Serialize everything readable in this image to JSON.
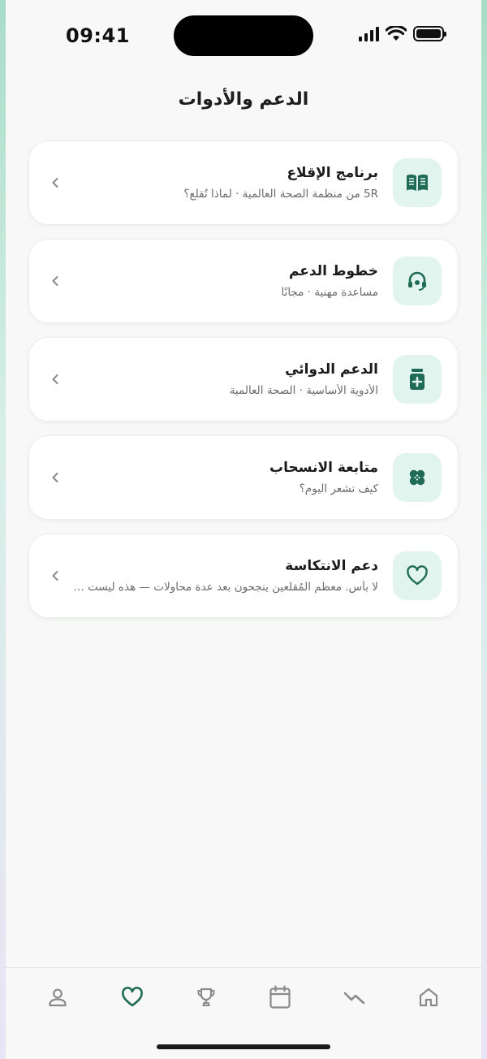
{
  "status_bar": {
    "time": "09:41"
  },
  "header": {
    "title": "الدعم والأدوات"
  },
  "cards": [
    {
      "title": "برنامج الإقلاع",
      "subtitle": "5R من منظمة الصحة العالمية · لماذا تُقلع؟",
      "icon": "book-icon"
    },
    {
      "title": "خطوط الدعم",
      "subtitle": "مساعدة مهنية · مجانًا",
      "icon": "headset-icon"
    },
    {
      "title": "الدعم الدوائي",
      "subtitle": "الأدوية الأساسية · الصحة العالمية",
      "icon": "medicine-icon"
    },
    {
      "title": "متابعة الانسحاب",
      "subtitle": "كيف تشعر اليوم؟",
      "icon": "bandage-icon"
    },
    {
      "title": "دعم الانتكاسة",
      "subtitle": "لا بأس. معظم المُقلعين ينجحون بعد عدة محاولات — هذه ليست فشلاً",
      "icon": "heart-icon"
    }
  ],
  "tab_bar": {
    "tabs": [
      {
        "icon": "person-icon",
        "active": false
      },
      {
        "icon": "heart-icon",
        "active": true
      },
      {
        "icon": "trophy-icon",
        "active": false
      },
      {
        "icon": "calendar-icon",
        "active": false
      },
      {
        "icon": "trend-down-icon",
        "active": false
      },
      {
        "icon": "home-icon",
        "active": false
      }
    ]
  },
  "colors": {
    "accent": "#1f6b55",
    "icon_bg": "#e2f4ee",
    "inactive": "#8a8a8a"
  }
}
